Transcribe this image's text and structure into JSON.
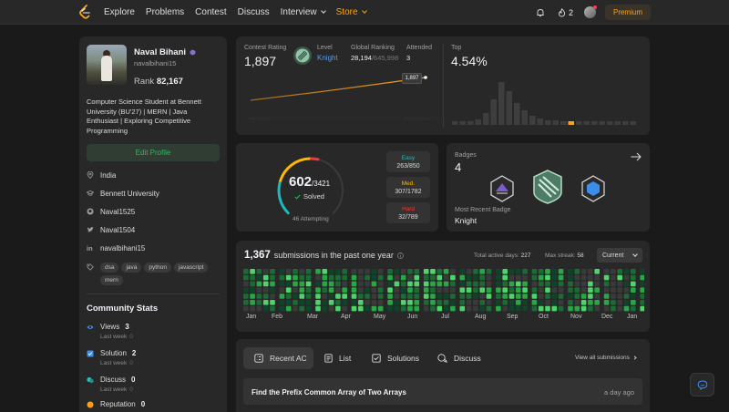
{
  "nav": {
    "links": [
      "Explore",
      "Problems",
      "Contest",
      "Discuss",
      "Interview",
      "Store"
    ],
    "streak": "2",
    "premium": "Premium"
  },
  "profile": {
    "name": "Naval Bihani",
    "username": "navalbihani15",
    "rank_label": "Rank",
    "rank": "82,167",
    "bio": "Computer Science Student at Bennett University (BU'27) | MERN | Java Enthusiast | Exploring Competitive Programming",
    "edit": "Edit Profile",
    "location": "India",
    "school": "Bennett University",
    "github": "Naval1525",
    "twitter": "Naval1504",
    "linkedin": "navalbihani15",
    "tags": [
      "dsa",
      "java",
      "python",
      "javascript",
      "mern"
    ]
  },
  "community": {
    "title": "Community Stats",
    "stats": [
      {
        "label": "Views",
        "value": "3",
        "sub": "Last week",
        "delta": "0"
      },
      {
        "label": "Solution",
        "value": "2",
        "sub": "Last week",
        "delta": "0"
      },
      {
        "label": "Discuss",
        "value": "0",
        "sub": "Last week",
        "delta": "0"
      },
      {
        "label": "Reputation",
        "value": "0"
      }
    ]
  },
  "rating": {
    "contest_label": "Contest Rating",
    "contest_value": "1,897",
    "level_label": "Level",
    "level_value": "Knight",
    "global_label": "Global Ranking",
    "global_value": "28,194",
    "global_total": "/645,998",
    "attended_label": "Attended",
    "attended_value": "3",
    "tooltip": "1,897",
    "top_label": "Top",
    "top_value": "4.54%",
    "chart_start": "Jan 2024",
    "chart_end": "Jan 2025"
  },
  "solved": {
    "count": "602",
    "total": "/3421",
    "label": "Solved",
    "attempting": "46 Attempting",
    "easy_label": "Easy",
    "easy_value": "263/850",
    "med_label": "Med.",
    "med_value": "307/1782",
    "hard_label": "Hard",
    "hard_value": "32/789",
    "easy_frac": 0.44,
    "med_frac": 0.51,
    "hard_frac": 0.05,
    "solved_frac": 0.176
  },
  "badges": {
    "title": "Badges",
    "count": "4",
    "recent_label": "Most Recent Badge",
    "recent_value": "Knight"
  },
  "submissions": {
    "count": "1,367",
    "text": "submissions in the past one year",
    "active_label": "Total active days:",
    "active_value": "227",
    "streak_label": "Max streak:",
    "streak_value": "58",
    "select": "Current",
    "months": [
      "Jan",
      "Feb",
      "Mar",
      "Apr",
      "May",
      "Jun",
      "Jul",
      "Aug",
      "Sep",
      "Oct",
      "Nov",
      "Dec",
      "Jan"
    ]
  },
  "tabs": {
    "items": [
      "Recent AC",
      "List",
      "Solutions",
      "Discuss"
    ],
    "view_all": "View all submissions",
    "first_item": "Find the Prefix Common Array of Two Arrays",
    "first_time": "a day ago"
  },
  "colors": {
    "accent": "#ffa116",
    "easy": "#1cbaba",
    "medium": "#ffb700",
    "hard": "#f63737",
    "green": "#2cbb5d",
    "knight_blue": "#5b9ae7"
  }
}
